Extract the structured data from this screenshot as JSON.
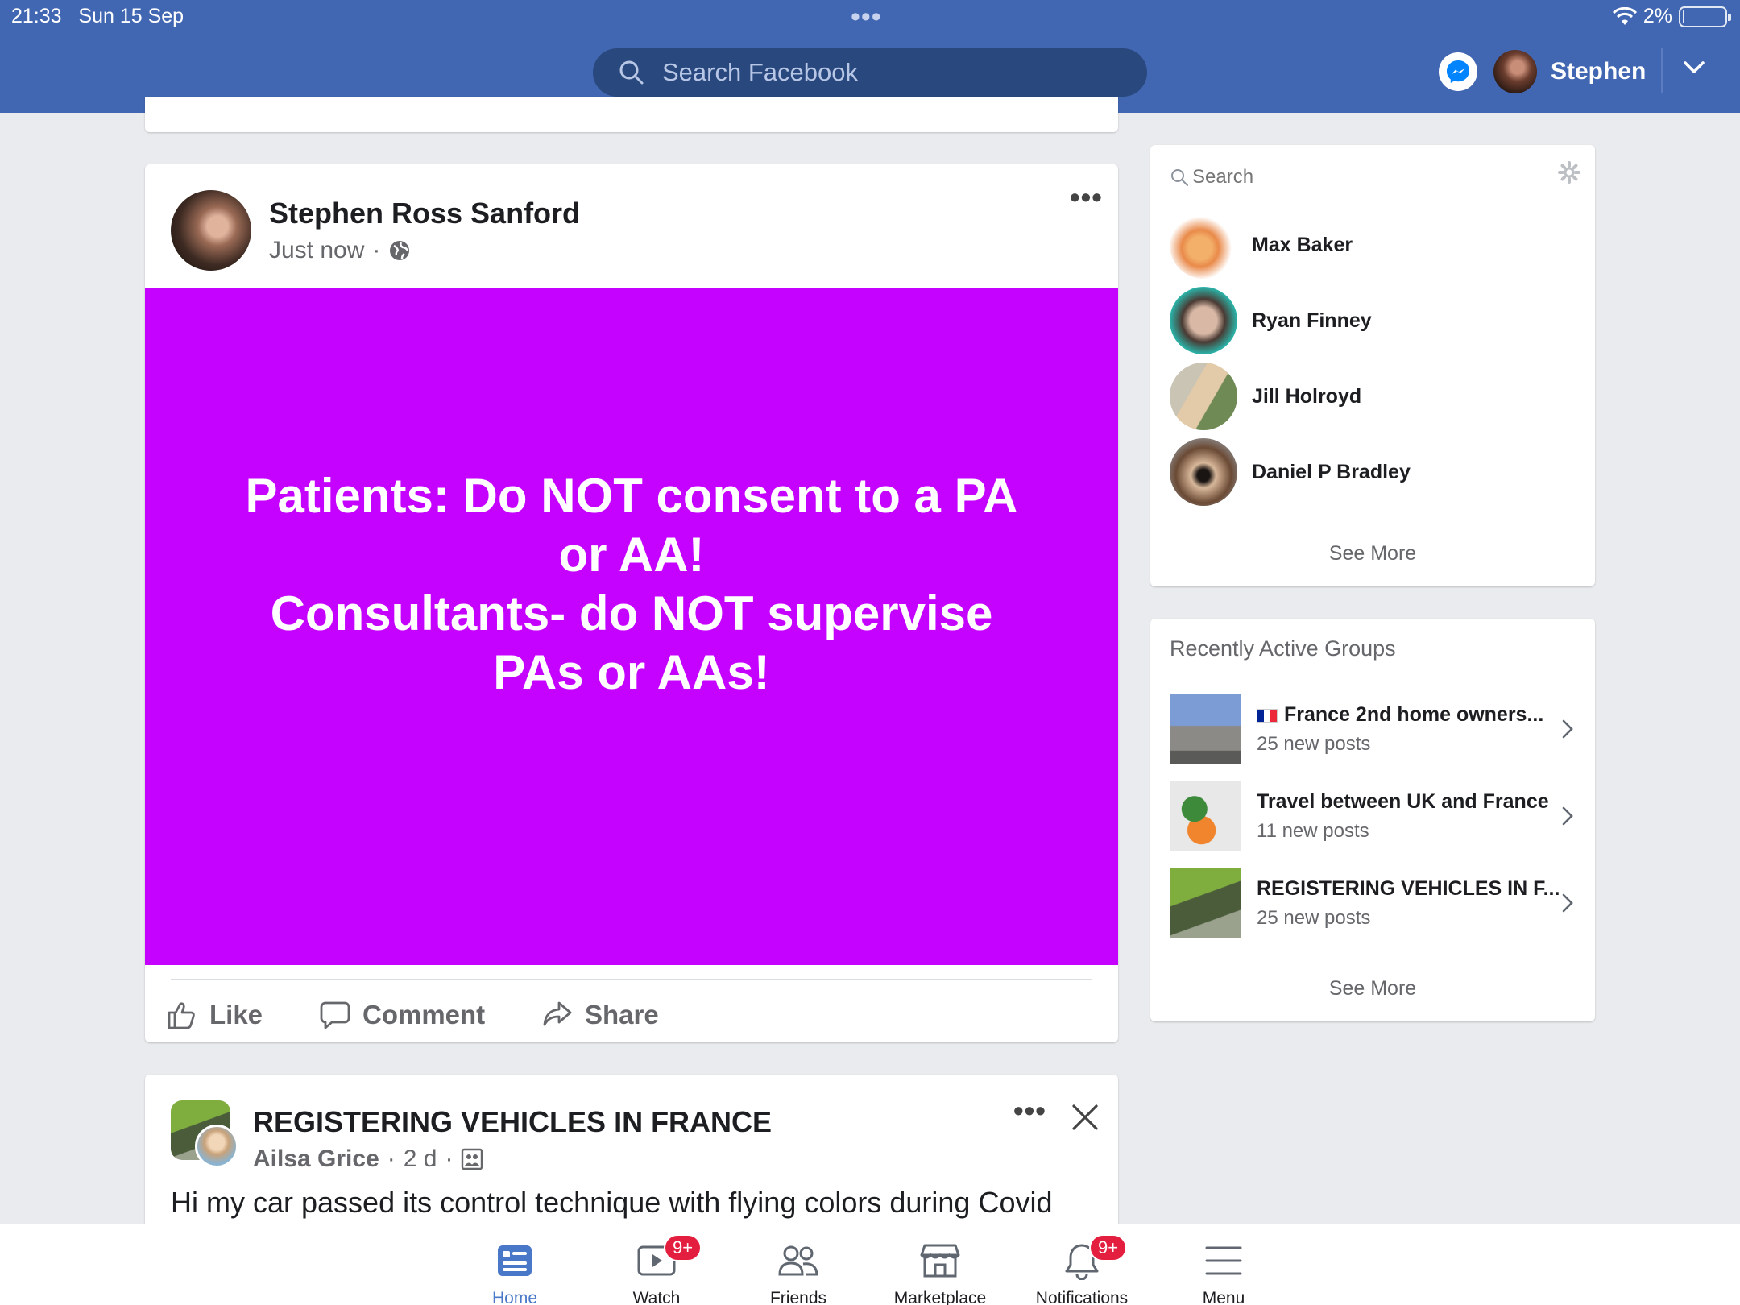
{
  "status_bar": {
    "time": "21:33",
    "date": "Sun 15 Sep",
    "battery": "2%",
    "battery_level": 0.02
  },
  "header": {
    "search_placeholder": "Search Facebook",
    "user_name": "Stephen"
  },
  "post1": {
    "author": "Stephen Ross Sanford",
    "time": "Just now",
    "privacy_icon": "globe-icon",
    "background_color": "#c501ff",
    "text": "Patients: Do NOT consent to a PA\nor AA!\nConsultants- do NOT supervise\nPAs or AAs!",
    "actions": {
      "like": "Like",
      "comment": "Comment",
      "share": "Share"
    }
  },
  "post2": {
    "group": "REGISTERING VEHICLES IN FRANCE",
    "author": "Ailsa Grice",
    "time": "2 d",
    "body": "Hi my car passed its control technique with flying colors during Covid"
  },
  "contacts": {
    "search_placeholder": "Search",
    "items": [
      {
        "name": "Max Baker"
      },
      {
        "name": "Ryan Finney"
      },
      {
        "name": "Jill Holroyd"
      },
      {
        "name": "Daniel P Bradley"
      }
    ],
    "see_more": "See More"
  },
  "groups": {
    "title": "Recently Active Groups",
    "items": [
      {
        "name": "France 2nd home owners...",
        "count": "25 new posts",
        "flag": "FR"
      },
      {
        "name": "Travel between UK and France",
        "count": "11 new posts"
      },
      {
        "name": "REGISTERING VEHICLES IN F...",
        "count": "25 new posts"
      }
    ],
    "see_more": "See More"
  },
  "tabbar": {
    "tabs": [
      {
        "label": "Home",
        "active": true
      },
      {
        "label": "Watch",
        "badge": "9+"
      },
      {
        "label": "Friends"
      },
      {
        "label": "Marketplace"
      },
      {
        "label": "Notifications",
        "badge": "9+"
      },
      {
        "label": "Menu"
      }
    ]
  },
  "colors": {
    "brand_blue": "#4267b2",
    "search_bg": "#29487d",
    "badge_red": "#e41e3f",
    "post_purple": "#c501ff"
  }
}
